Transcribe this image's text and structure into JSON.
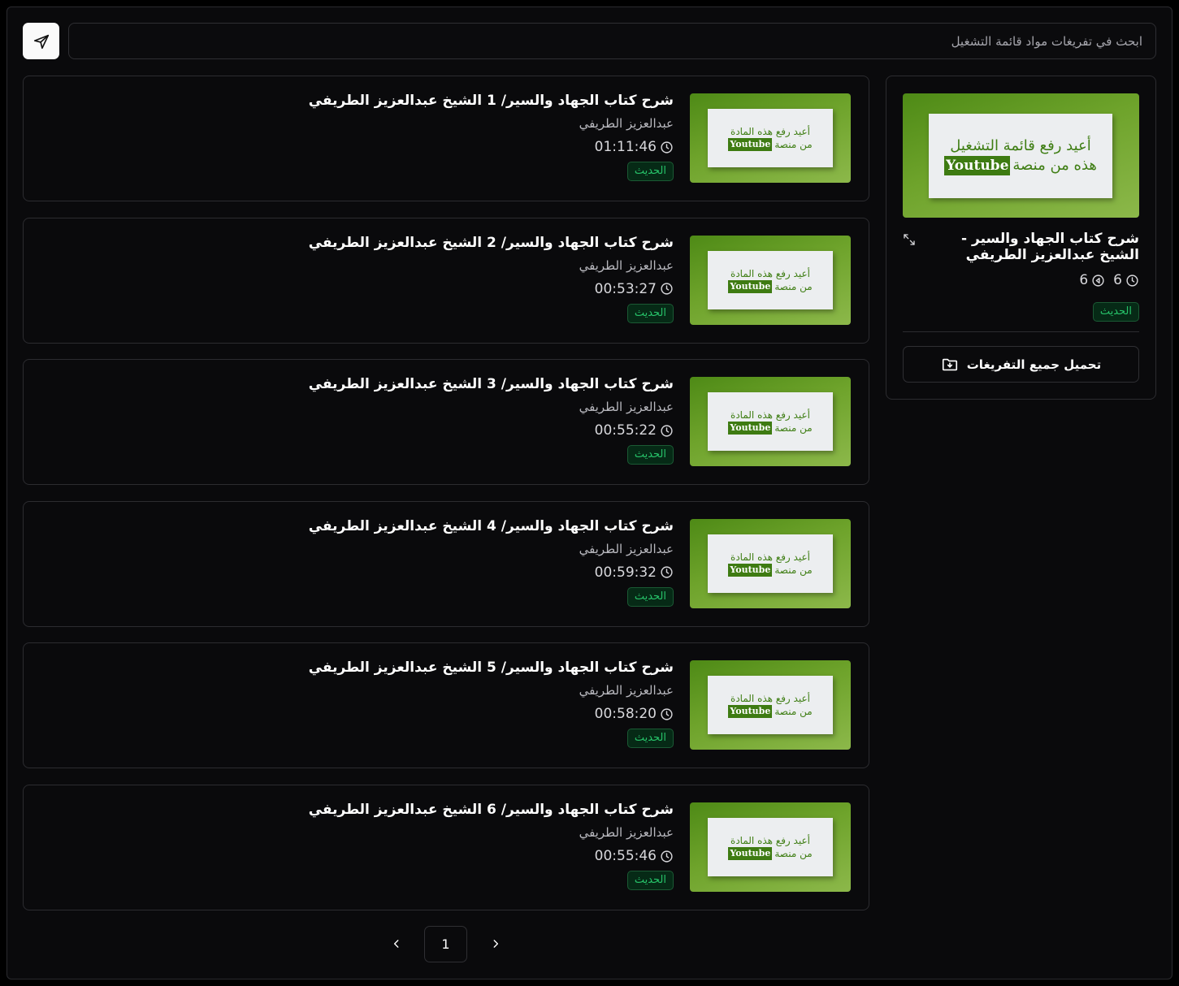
{
  "search": {
    "placeholder": "ابحث في تفريغات مواد قائمة التشغيل",
    "send_icon": "send-icon"
  },
  "thumbnail_text": {
    "line1": "أعيد رفع هذه المادة",
    "line2_prefix": "من منصة",
    "brand": "Youtube",
    "playlist_line1": "أعيد رفع قائمة التشغيل",
    "playlist_line2_prefix": "هذه من منصة"
  },
  "episodes": [
    {
      "title": "شرح كتاب الجهاد والسير/ 1 الشيخ عبدالعزيز الطريفي",
      "author": "عبدالعزيز الطريفي",
      "duration": "01:11:46",
      "badge": "الحديث"
    },
    {
      "title": "شرح كتاب الجهاد والسير/ 2 الشيخ عبدالعزيز الطريفي",
      "author": "عبدالعزيز الطريفي",
      "duration": "00:53:27",
      "badge": "الحديث"
    },
    {
      "title": "شرح كتاب الجهاد والسير/ 3 الشيخ عبدالعزيز الطريفي",
      "author": "عبدالعزيز الطريفي",
      "duration": "00:55:22",
      "badge": "الحديث"
    },
    {
      "title": "شرح كتاب الجهاد والسير/ 4 الشيخ عبدالعزيز الطريفي",
      "author": "عبدالعزيز الطريفي",
      "duration": "00:59:32",
      "badge": "الحديث"
    },
    {
      "title": "شرح كتاب الجهاد والسير/ 5 الشيخ عبدالعزيز الطريفي",
      "author": "عبدالعزيز الطريفي",
      "duration": "00:58:20",
      "badge": "الحديث"
    },
    {
      "title": "شرح كتاب الجهاد والسير/ 6 الشيخ عبدالعزيز الطريفي",
      "author": "عبدالعزيز الطريفي",
      "duration": "00:55:46",
      "badge": "الحديث"
    }
  ],
  "playlist": {
    "title": "شرح كتاب الجهاد والسير - الشيخ عبدالعزيز الطريفي",
    "duration_count": "6",
    "play_count": "6",
    "badge": "الحديث",
    "download_label": "تحميل جميع التفريغات"
  },
  "pagination": {
    "current_page": "1"
  },
  "colors": {
    "background": "#0a0a0c",
    "accent_green": "#27c46a",
    "thumbnail_green": "#4e8a16"
  }
}
